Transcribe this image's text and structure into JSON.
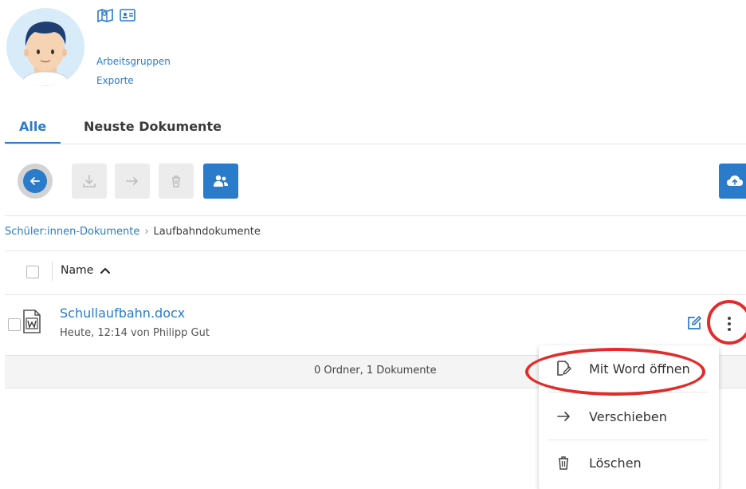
{
  "profile": {
    "avatar_icon": "user-avatar",
    "top_icons": [
      "map-icon",
      "id-card-icon"
    ],
    "links": [
      "Arbeitsgruppen",
      "Exporte"
    ]
  },
  "tabs": [
    {
      "label": "Alle",
      "active": true
    },
    {
      "label": "Neuste Dokumente",
      "active": false
    }
  ],
  "toolbar": {
    "buttons": [
      "back-arrow-icon",
      "download-icon",
      "move-arrow-icon",
      "trash-icon",
      "share-users-icon",
      "cloud-upload-icon"
    ],
    "accent": "#2a7bc9"
  },
  "breadcrumb": {
    "parent": "Schüler:innen-Dokumente",
    "separator": "›",
    "current": "Laufbahndokumente"
  },
  "table": {
    "name_header": "Name",
    "rows": [
      {
        "name": "Schullaufbahn.docx",
        "meta": "Heute, 12:14 von Philipp Gut",
        "type_icon": "word-file-icon"
      }
    ],
    "summary": "0 Ordner, 1 Dokumente"
  },
  "context_menu": {
    "items": [
      {
        "label": "Mit Word öffnen",
        "icon": "word-open-icon"
      },
      {
        "label": "Verschieben",
        "icon": "arrow-right-icon"
      },
      {
        "label": "Löschen",
        "icon": "trash-icon"
      }
    ]
  },
  "annotation_color": "#e32b2b"
}
